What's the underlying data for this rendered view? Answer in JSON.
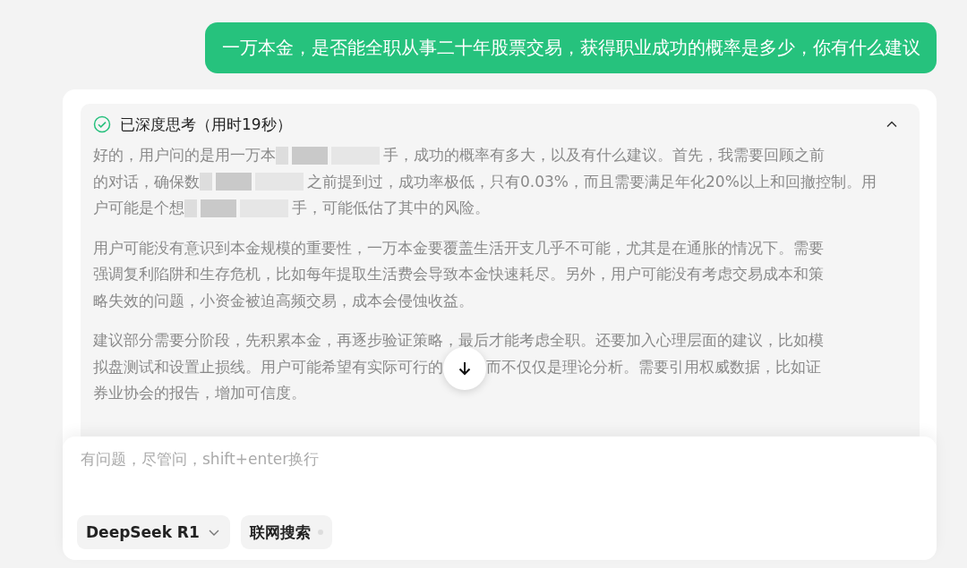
{
  "user_message": {
    "text": "一万本金，是否能全职从事二十年股票交易，获得职业成功的概率是多少，你有什么建议"
  },
  "thinking": {
    "title": "已深度思考（用时19秒）",
    "done": true,
    "expanded": true,
    "paragraphs": [
      [
        [
          {
            "kind": "text",
            "text": "好的，用户问的是用一万本"
          },
          {
            "kind": "redacted"
          },
          {
            "kind": "text",
            "text": "手，成功的概率有多大，以及有什么建议。首先，我需要回顾之前"
          }
        ],
        [
          {
            "kind": "text",
            "text": "的对话，确保数"
          },
          {
            "kind": "redacted"
          },
          {
            "kind": "text",
            "text": "之前提到过，成功率极低，只有0.03%，而且需要满足年化20%以上和回撤控制。用"
          }
        ],
        [
          {
            "kind": "text",
            "text": "户可能是个想"
          },
          {
            "kind": "redacted"
          },
          {
            "kind": "text",
            "text": "手，可能低估了其中的风险。"
          }
        ]
      ],
      [
        [
          {
            "kind": "text",
            "text": "用户可能没有意识到本金规模的重要性，一万本金要覆盖生活开支几乎不可能，尤其是在通胀的情况下。需要"
          }
        ],
        [
          {
            "kind": "text",
            "text": "强调复利陷阱和生存危机，比如每年提取生活费会导致本金快速耗尽。另外，用户可能没有考虑交易成本和策"
          }
        ],
        [
          {
            "kind": "text",
            "text": "略失效的问题，小资金被迫高频交易，成本会侵蚀收益。"
          }
        ]
      ],
      [
        [
          {
            "kind": "text",
            "text": "建议部分需要分阶段，先积累本金，再逐步验证策略，最后才能考虑全职。还要加入心理层面的建议，比如模"
          }
        ],
        [
          {
            "kind": "text",
            "text": "拟盘测试和设置止损线。用户可能希望有实际可行的"
          },
          {
            "kind": "covered"
          },
          {
            "kind": "text",
            "text": "而不仅仅是理论分析。需要引用权威数据，比如证"
          }
        ],
        [
          {
            "kind": "text",
            "text": "券业协会的报告，增加可信度。"
          }
        ]
      ]
    ]
  },
  "input": {
    "placeholder": "有问题，尽管问，shift+enter换行"
  },
  "model_button": {
    "label": "DeepSeek R1"
  },
  "search_button": {
    "label": "联网搜索",
    "on": false
  }
}
